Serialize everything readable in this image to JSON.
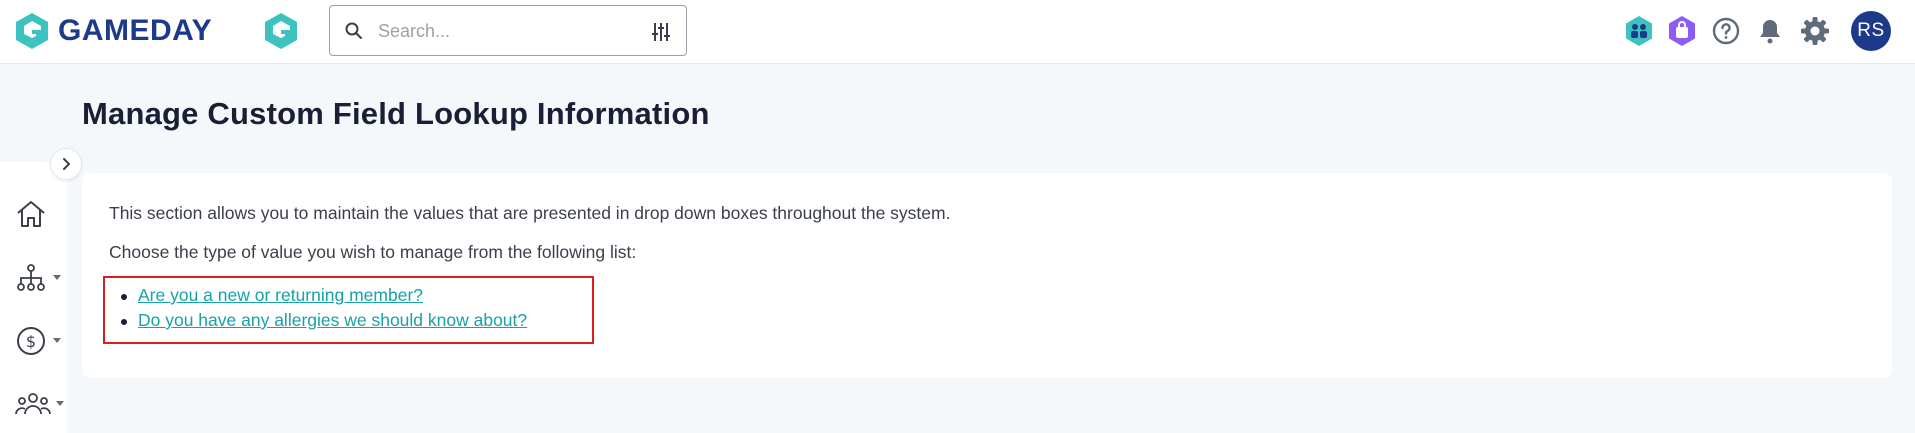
{
  "header": {
    "brand": "GAMEDAY",
    "search": {
      "placeholder": "Search...",
      "value": ""
    },
    "user_initials": "RS",
    "icons": [
      "teams-hub-icon",
      "shop-bag-icon",
      "help-icon",
      "notifications-bell-icon",
      "settings-gear-icon"
    ]
  },
  "sidebar": {
    "items": [
      {
        "icon": "home-icon",
        "has_dropdown": false
      },
      {
        "icon": "org-chart-icon",
        "has_dropdown": true
      },
      {
        "icon": "finance-dollar-icon",
        "has_dropdown": true
      },
      {
        "icon": "members-group-icon",
        "has_dropdown": true
      }
    ]
  },
  "main": {
    "title": "Manage Custom Field Lookup Information",
    "intro": "This section allows you to maintain the values that are presented in drop down boxes throughout the system.",
    "instruction": "Choose the type of value you wish to manage from the following list:",
    "links": [
      {
        "label": "Are you a new or returning member?"
      },
      {
        "label": "Do you have any allergies we should know about?"
      }
    ]
  },
  "colors": {
    "brand_navy": "#1d3a8a",
    "brand_teal": "#3cc3c0",
    "link": "#17a2a6",
    "highlight_border": "#d81e1e",
    "background": "#f5f8fb"
  }
}
